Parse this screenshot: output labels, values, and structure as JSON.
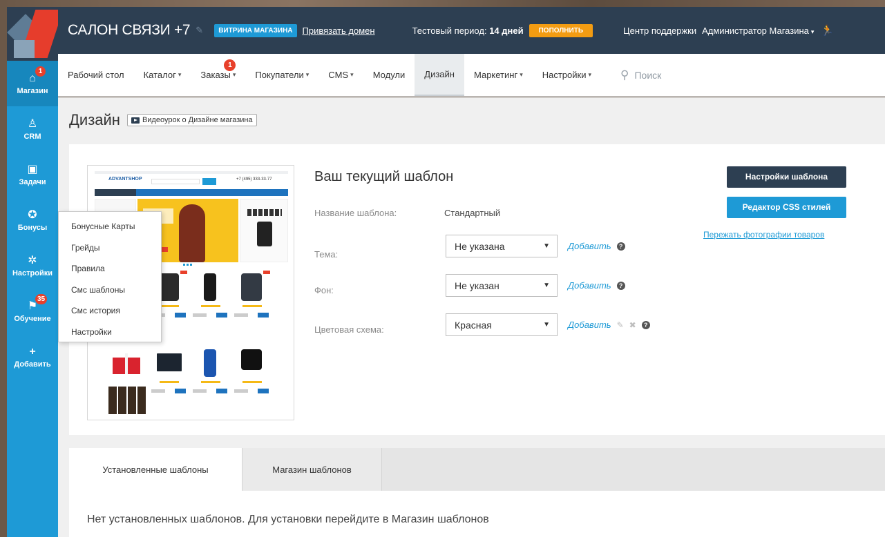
{
  "header": {
    "site_title": "САЛОН СВЯЗИ +7",
    "store_badge": "ВИТРИНА МАГАЗИНА",
    "bind_domain": "Привязать домен",
    "trial_prefix": "Тестовый период:",
    "trial_days": "14 дней",
    "topup": "ПОПОЛНИТЬ",
    "support": "Центр поддержки",
    "admin": "Администратор Магазина"
  },
  "sidebar": {
    "items": [
      {
        "label": "Магазин",
        "icon": "store-icon",
        "badge": "1"
      },
      {
        "label": "CRM",
        "icon": "crm-icon"
      },
      {
        "label": "Задачи",
        "icon": "tasks-icon"
      },
      {
        "label": "Бонусы",
        "icon": "bonus-icon"
      },
      {
        "label": "Настройки",
        "icon": "gear-icon"
      },
      {
        "label": "Обучение",
        "icon": "learn-icon",
        "badge": "35"
      },
      {
        "label": "Добавить",
        "icon": "plus-icon"
      }
    ]
  },
  "nav": {
    "items": [
      {
        "label": "Рабочий стол"
      },
      {
        "label": "Каталог"
      },
      {
        "label": "Заказы",
        "badge": "1"
      },
      {
        "label": "Покупатели"
      },
      {
        "label": "CMS"
      },
      {
        "label": "Модули"
      },
      {
        "label": "Дизайн"
      },
      {
        "label": "Маркетинг"
      },
      {
        "label": "Настройки"
      }
    ],
    "search_placeholder": "Поиск"
  },
  "page": {
    "title": "Дизайн",
    "video_button": "Видеоурок о Дизайне магазина"
  },
  "preview": {
    "logo": "ADVANTSHOP",
    "phone": "+7 (495) 333-33-77"
  },
  "template": {
    "heading": "Ваш текущий шаблон",
    "name_label": "Название шаблона:",
    "name_value": "Стандартный",
    "theme_label": "Тема:",
    "theme_value": "Не указана",
    "bg_label": "Фон:",
    "bg_value": "Не указан",
    "scheme_label": "Цветовая схема:",
    "scheme_value": "Красная",
    "add_link": "Добавить",
    "settings_button": "Настройки шаблона",
    "css_button": "Редактор CSS стилей",
    "photos_link": "Пережать фотографии товаров"
  },
  "tabs": {
    "installed": "Установленные шаблоны",
    "store": "Магазин шаблонов",
    "empty_message": "Нет установленных шаблонов. Для установки перейдите в Магазин шаблонов"
  },
  "dropdown": {
    "items": [
      "Бонусные Карты",
      "Грейды",
      "Правила",
      "Смс шаблоны",
      "Смс история",
      "Настройки"
    ]
  },
  "colors": {
    "sidebar": "#1e9ad6",
    "header": "#2d3f52",
    "accent": "#1e9ad6",
    "badge": "#e8402b",
    "topup": "#f39c12"
  }
}
